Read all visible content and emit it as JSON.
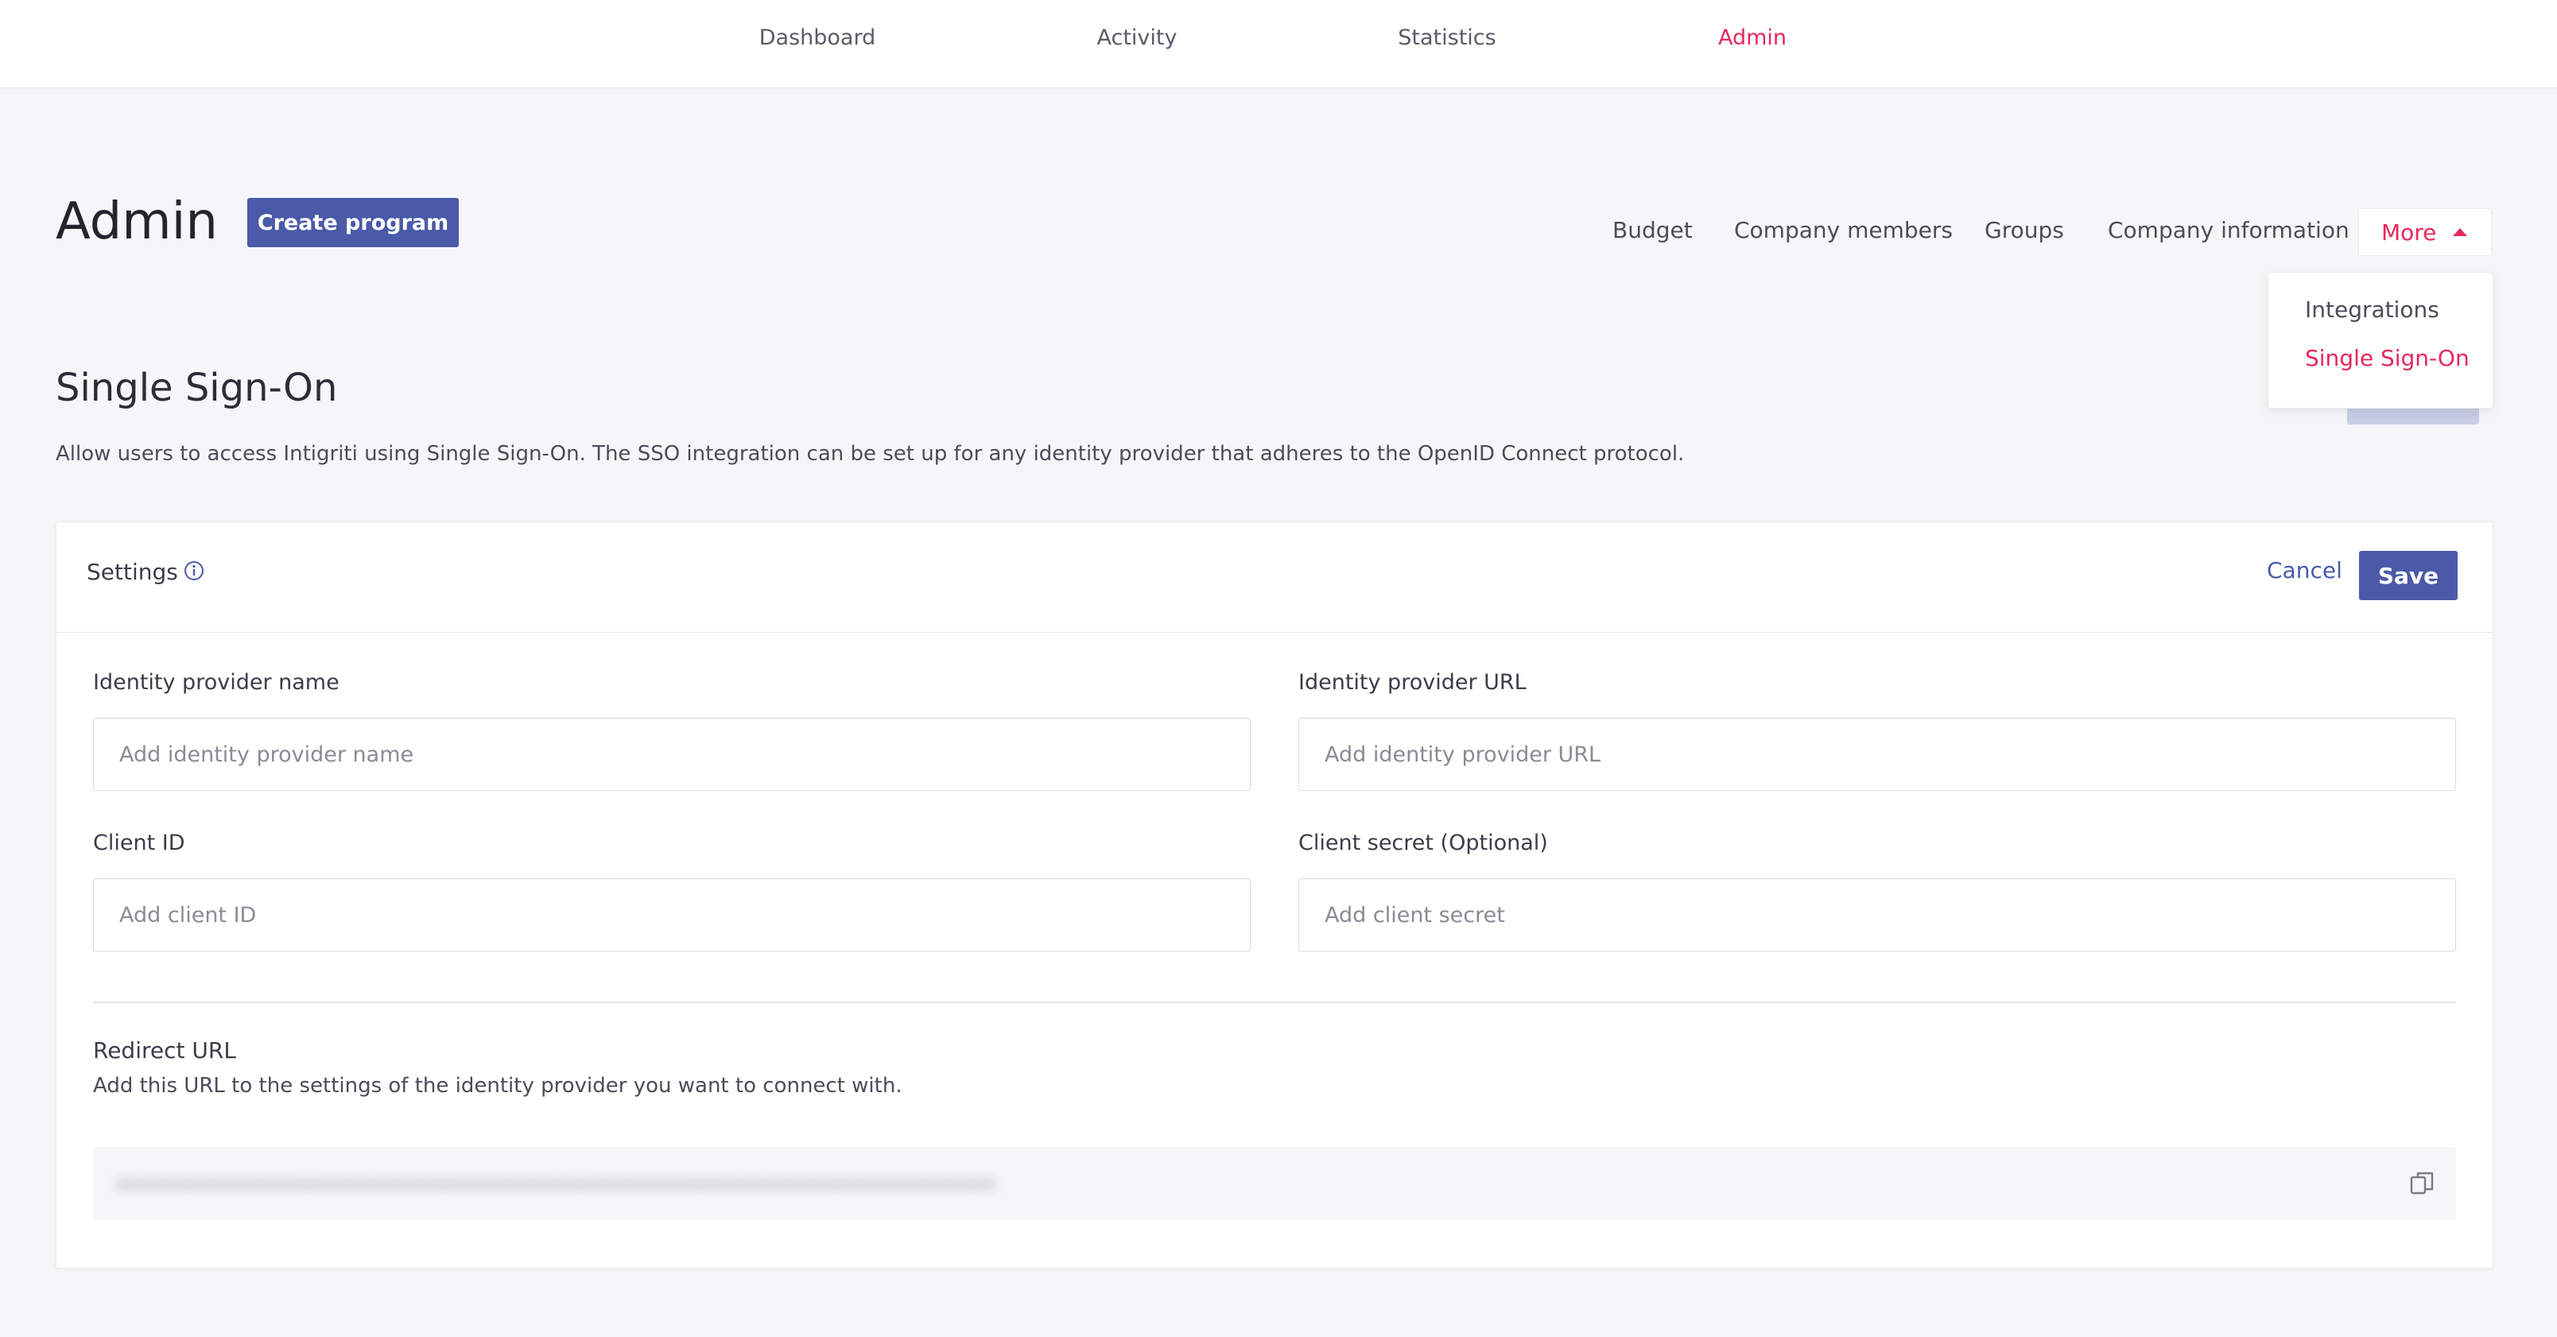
{
  "topnav": {
    "items": [
      {
        "label": "Dashboard",
        "active": false
      },
      {
        "label": "Activity",
        "active": false
      },
      {
        "label": "Statistics",
        "active": false
      },
      {
        "label": "Admin",
        "active": true
      }
    ]
  },
  "header": {
    "title": "Admin",
    "create_button": "Create program"
  },
  "subnav": {
    "items": [
      "Budget",
      "Company members",
      "Groups",
      "Company information"
    ],
    "more_label": "More",
    "more_menu": [
      "Integrations",
      "Single Sign-On"
    ],
    "more_menu_selected": "Single Sign-On"
  },
  "section": {
    "title": "Single Sign-On",
    "description": "Allow users to access Intigriti using Single Sign-On. The SSO integration can be set up for any identity provider that adheres to the OpenID Connect protocol."
  },
  "card": {
    "title": "Settings",
    "cancel_label": "Cancel",
    "save_label": "Save",
    "fields": {
      "idp_name": {
        "label": "Identity provider name",
        "placeholder": "Add identity provider name",
        "value": ""
      },
      "idp_url": {
        "label": "Identity provider URL",
        "placeholder": "Add identity provider URL",
        "value": ""
      },
      "client_id": {
        "label": "Client ID",
        "placeholder": "Add client ID",
        "value": ""
      },
      "client_secret": {
        "label": "Client secret (Optional)",
        "placeholder": "Add client secret",
        "value": ""
      }
    },
    "redirect": {
      "title": "Redirect URL",
      "description": "Add this URL to the settings of the identity provider you want to connect with.",
      "url_blurred": true
    }
  },
  "icons": {
    "info": "info-circle-icon",
    "copy": "copy-icon",
    "caret": "caret-up-icon"
  },
  "colors": {
    "accent": "#e8275a",
    "primary": "#4a5aa8",
    "background": "#f6f6f8"
  }
}
